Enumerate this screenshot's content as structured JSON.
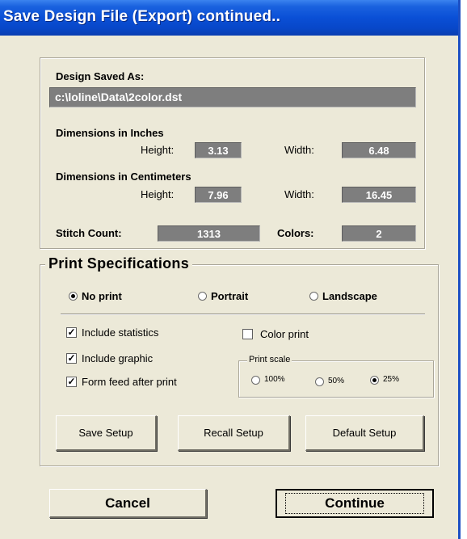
{
  "window": {
    "title": "Save Design File (Export) continued.."
  },
  "design": {
    "saved_as_label": "Design Saved As:",
    "path": "c:\\loline\\Data\\2color.dst",
    "inches_label": "Dimensions in Inches",
    "inches_height": "3.13",
    "inches_width": "6.48",
    "cm_label": "Dimensions in Centimeters",
    "cm_height": "7.96",
    "cm_width": "16.45",
    "height_label": "Height:",
    "width_label": "Width:",
    "stitch_label": "Stitch Count:",
    "stitch_count": "1313",
    "colors_label": "Colors:",
    "colors": "2"
  },
  "print": {
    "title": "Print Specifications",
    "orientation": [
      {
        "label": "No print",
        "selected": true
      },
      {
        "label": "Portrait",
        "selected": false
      },
      {
        "label": "Landscape",
        "selected": false
      }
    ],
    "options": [
      {
        "label": "Include statistics",
        "checked": true
      },
      {
        "label": "Include graphic",
        "checked": true
      },
      {
        "label": "Form feed after print",
        "checked": true
      }
    ],
    "color_print": {
      "label": "Color print",
      "checked": false
    },
    "scale": {
      "label": "Print scale",
      "options": [
        {
          "label": "100%",
          "selected": false
        },
        {
          "label": "50%",
          "selected": false
        },
        {
          "label": "25%",
          "selected": true
        }
      ]
    },
    "buttons": {
      "save": "Save Setup",
      "recall": "Recall Setup",
      "default": "Default Setup"
    }
  },
  "footer": {
    "cancel": "Cancel",
    "continue": "Continue"
  }
}
